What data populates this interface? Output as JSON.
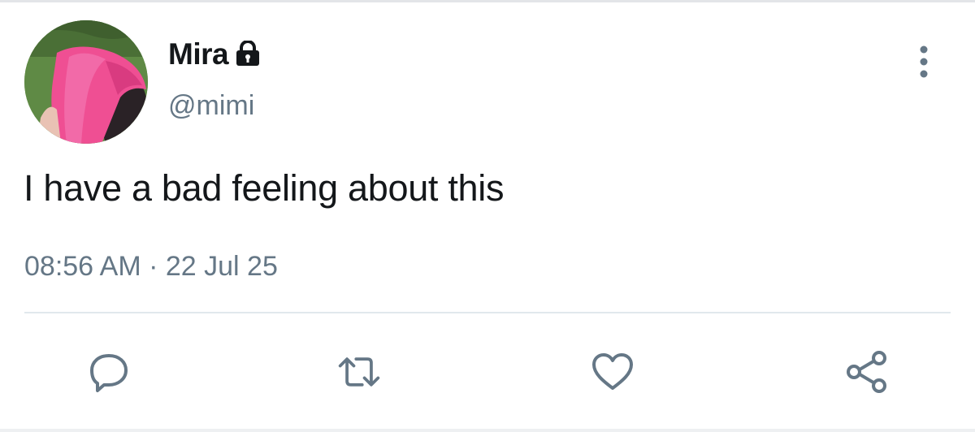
{
  "tweet": {
    "display_name": "Mira",
    "handle": "@mimi",
    "text": "I have a bad feeling about this",
    "timestamp": "08:56 AM · 22 Jul 25",
    "locked": true
  },
  "icons": {
    "lock": "lock-icon",
    "more": "more-vertical-icon",
    "reply": "reply-icon",
    "retweet": "retweet-icon",
    "like": "heart-icon",
    "share": "share-icon"
  },
  "colors": {
    "text_primary": "#14171a",
    "text_secondary": "#657786",
    "icon": "#657786",
    "divider": "#e1e8ed"
  }
}
